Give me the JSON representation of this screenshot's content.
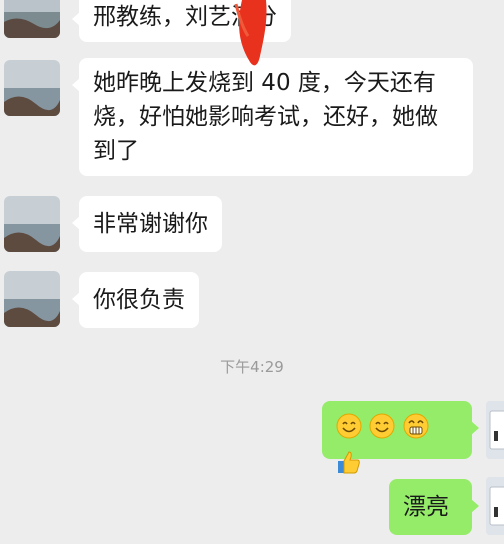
{
  "messages": [
    {
      "text": "邢教练，刘艺满分"
    },
    {
      "text": "她昨晚上发烧到 40 度，今天还有烧，好怕她影响考试，还好，她做到了"
    },
    {
      "text": "非常谢谢你"
    },
    {
      "text": "你很负责"
    }
  ],
  "msg2_lines": [
    "她昨晚上发烧到 40 度，今天还有",
    "烧，好怕她影响考试，还好，她做",
    "到了"
  ],
  "timestamp": "下午4:29",
  "outgoing": [
    {
      "icons": [
        "smile-icon",
        "smile-icon",
        "grin-icon",
        "thumbs-up-icon"
      ]
    },
    {
      "text": "漂亮"
    }
  ],
  "colors": {
    "background": "#ededed",
    "incoming": "#ffffff",
    "outgoing": "#95ec69",
    "redaction": "#e8321e"
  }
}
